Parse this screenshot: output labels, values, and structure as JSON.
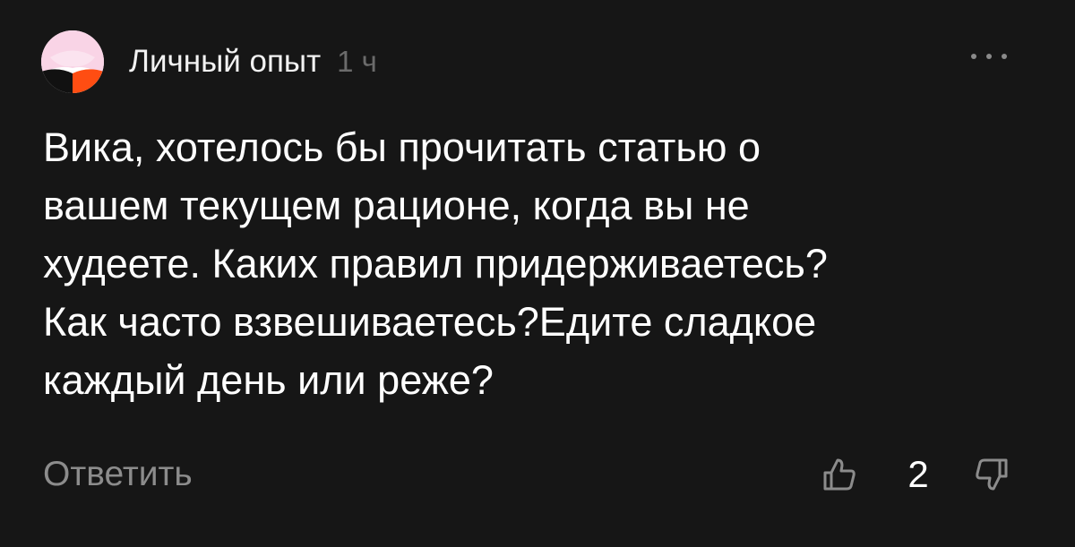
{
  "comment": {
    "author": "Личный опыт",
    "time": "1 ч",
    "text": "Вика, хотелось бы прочитать статью о\nвашем текущем рационе, когда вы не\nхудеете. Каких правил придерживаетесь?\nКак часто взвешиваетесь?Едите сладкое\nкаждый день или реже?",
    "reply_label": "Ответить",
    "likes_count": "2"
  },
  "icons": {
    "avatar": "avatar-image",
    "more": "more-horizontal-icon",
    "like": "thumbs-up-icon",
    "dislike": "thumbs-down-icon"
  },
  "colors": {
    "background": "#161616",
    "text": "#ffffff",
    "muted": "#8c8c8c",
    "avatar_pink": "#f7c6dc",
    "avatar_orange": "#ff4d12",
    "avatar_black": "#111111"
  }
}
